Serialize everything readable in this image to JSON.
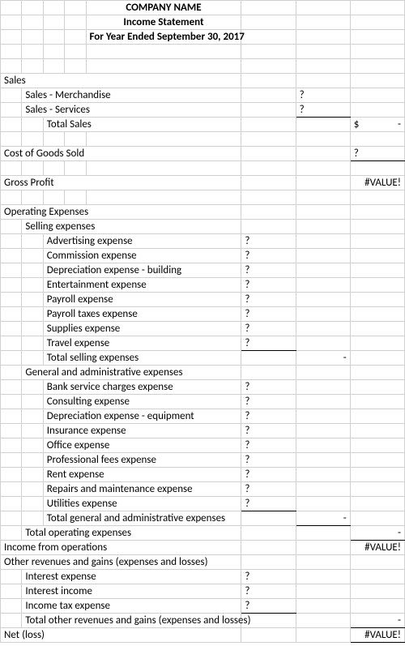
{
  "header": {
    "company": "COMPANY NAME",
    "title": "Income Statement",
    "period": "For Year Ended September 30, 2017"
  },
  "sections": {
    "sales": {
      "heading": "Sales",
      "merchandise": {
        "label": "Sales - Merchandise",
        "value": "?"
      },
      "services": {
        "label": "Sales - Services",
        "value": "?"
      },
      "total": {
        "label": "Total Sales",
        "currency": "$",
        "value": "-"
      }
    },
    "cogs": {
      "label": "Cost of Goods Sold",
      "value": "?"
    },
    "gross_profit": {
      "label": "Gross Profit",
      "value": "#VALUE!"
    },
    "opex": {
      "heading": "Operating Expenses",
      "selling": {
        "heading": "Selling expenses",
        "items": [
          {
            "label": "Advertising expense",
            "value": "?"
          },
          {
            "label": "Commission expense",
            "value": "?"
          },
          {
            "label": "Depreciation expense - building",
            "value": "?"
          },
          {
            "label": "Entertainment expense",
            "value": "?"
          },
          {
            "label": "Payroll expense",
            "value": "?"
          },
          {
            "label": "Payroll taxes expense",
            "value": "?"
          },
          {
            "label": "Supplies expense",
            "value": "?"
          },
          {
            "label": "Travel expense",
            "value": "?"
          }
        ],
        "total": {
          "label": "Total selling expenses",
          "value": "-"
        }
      },
      "ga": {
        "heading": "General and administrative expenses",
        "items": [
          {
            "label": "Bank service charges expense",
            "value": "?"
          },
          {
            "label": "Consulting expense",
            "value": "?"
          },
          {
            "label": "Depreciation expense - equipment",
            "value": "?"
          },
          {
            "label": "Insurance expense",
            "value": "?"
          },
          {
            "label": "Office expense",
            "value": "?"
          },
          {
            "label": "Professional fees expense",
            "value": "?"
          },
          {
            "label": "Rent expense",
            "value": "?"
          },
          {
            "label": "Repairs and maintenance expense",
            "value": "?"
          },
          {
            "label": "Utilities expense",
            "value": "?"
          }
        ],
        "total": {
          "label": "Total general and administrative expenses",
          "value": "-"
        }
      },
      "total": {
        "label": "Total operating expenses",
        "value": "-"
      }
    },
    "income_ops": {
      "label": "Income from operations",
      "value": "#VALUE!"
    },
    "other": {
      "heading": "Other revenues and gains (expenses and losses)",
      "items": [
        {
          "label": "Interest expense",
          "value": "?"
        },
        {
          "label": "Interest income",
          "value": "?"
        },
        {
          "label": "Income tax expense",
          "value": "?"
        }
      ],
      "total": {
        "label": "Total other revenues and gains (expenses and losses)",
        "value": "-"
      }
    },
    "net": {
      "label": "Net (loss)",
      "value": "#VALUE!"
    }
  }
}
